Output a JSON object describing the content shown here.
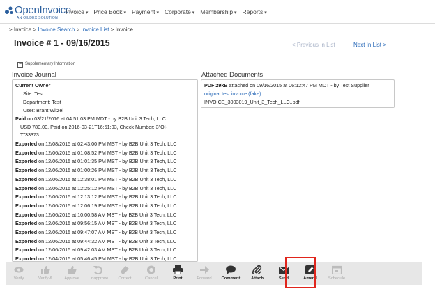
{
  "app": {
    "logo_text": "OpenInvoice",
    "logo_sub": "AN OILDEX SOLUTION",
    "brand_color": "#2b5f9e",
    "accent_color": "#2a6ab8",
    "highlight_color": "#e0251c"
  },
  "nav": {
    "items": [
      "Invoice",
      "Price Book",
      "Payment",
      "Corporate",
      "Membership",
      "Reports"
    ]
  },
  "breadcrumb": {
    "sep": ">",
    "items": [
      "Invoice",
      "Invoice Search",
      "Invoice List",
      "Invoice"
    ]
  },
  "page": {
    "title": "Invoice # 1 - 09/16/2015",
    "prev": "< Previous In List",
    "next": "Next In List >"
  },
  "supplementary": {
    "toggle": "−",
    "label": "Supplementary Information"
  },
  "journal": {
    "heading": "Invoice Journal",
    "owner_title": "Current Owner",
    "owner_site": "Site: Test",
    "owner_dept": "Department: Test",
    "owner_user": "User: Brant Witzel",
    "paid_label": "Paid",
    "paid_text": " on 03/21/2016 at 04:51:03 PM MDT - by  B2B Unit 3 Tech, LLC",
    "paid_detail1": "USD 780.00. Paid on 2016-03-21T16:51:03, Check Number: 3\"OI-",
    "paid_detail2": "T\"33373",
    "exported_label": "Exported",
    "exports": [
      " on 12/08/2015 at 02:43:00 PM MST - by B2B Unit 3 Tech, LLC",
      " on 12/06/2015 at 01:08:52 PM MST - by B2B Unit 3 Tech, LLC",
      " on 12/06/2015 at 01:01:35 PM MST - by B2B Unit 3 Tech, LLC",
      " on 12/06/2015 at 01:00:26 PM MST - by B2B Unit 3 Tech, LLC",
      " on 12/06/2015 at 12:38:01 PM MST - by B2B Unit 3 Tech, LLC",
      " on 12/06/2015 at 12:25:12 PM MST - by B2B Unit 3 Tech, LLC",
      " on 12/06/2015 at 12:13:12 PM MST - by B2B Unit 3 Tech, LLC",
      " on 12/06/2015 at 12:06:19 PM MST - by B2B Unit 3 Tech, LLC",
      " on 12/06/2015 at 10:00:58 AM MST - by B2B Unit 3 Tech, LLC",
      " on 12/06/2015 at 09:56:15 AM MST - by B2B Unit 3 Tech, LLC",
      " on 12/06/2015 at 09:47:07 AM MST - by B2B Unit 3 Tech, LLC",
      " on 12/06/2015 at 09:44:32 AM MST - by B2B Unit 3 Tech, LLC",
      " on 12/06/2015 at 09:42:03 AM MST - by B2B Unit 3 Tech, LLC",
      " on 12/04/2015 at 05:46:45 PM MST - by B2B Unit 3 Tech, LLC"
    ]
  },
  "documents": {
    "heading": "Attached Documents",
    "type_size": "PDF 29kB",
    "attached_text": "  attached on 09/16/2015 at 06:12:47 PM MDT - by Test Supplier",
    "link": "original test invoice (fake)",
    "filename": "INVOICE_3003019_Unit_3_Tech_LLC..pdf"
  },
  "toolbar": {
    "buttons": [
      {
        "label": "Verify",
        "icon": "eye-icon",
        "enabled": false
      },
      {
        "label": "Verify &",
        "icon": "thumbs-up-icon",
        "enabled": false
      },
      {
        "label": "Approve",
        "icon": "thumbs-up-icon",
        "enabled": false
      },
      {
        "label": "Unapprove",
        "icon": "undo-icon",
        "enabled": false
      },
      {
        "label": "Correct",
        "icon": "eraser-icon",
        "enabled": false
      },
      {
        "label": "Cancel",
        "icon": "cancel-icon",
        "enabled": false
      },
      {
        "label": "Print",
        "icon": "printer-icon",
        "enabled": true
      },
      {
        "label": "Forward",
        "icon": "arrow-right-icon",
        "enabled": false
      },
      {
        "label": "Comment",
        "icon": "speech-bubble-icon",
        "enabled": true
      },
      {
        "label": "Attach",
        "icon": "paperclip-icon",
        "enabled": true
      },
      {
        "label": "Send",
        "icon": "envelope-icon",
        "enabled": true
      },
      {
        "label": "Amend",
        "icon": "edit-pencil-icon",
        "enabled": true
      },
      {
        "label": "Schedule",
        "icon": "calendar-icon",
        "enabled": false
      }
    ]
  }
}
